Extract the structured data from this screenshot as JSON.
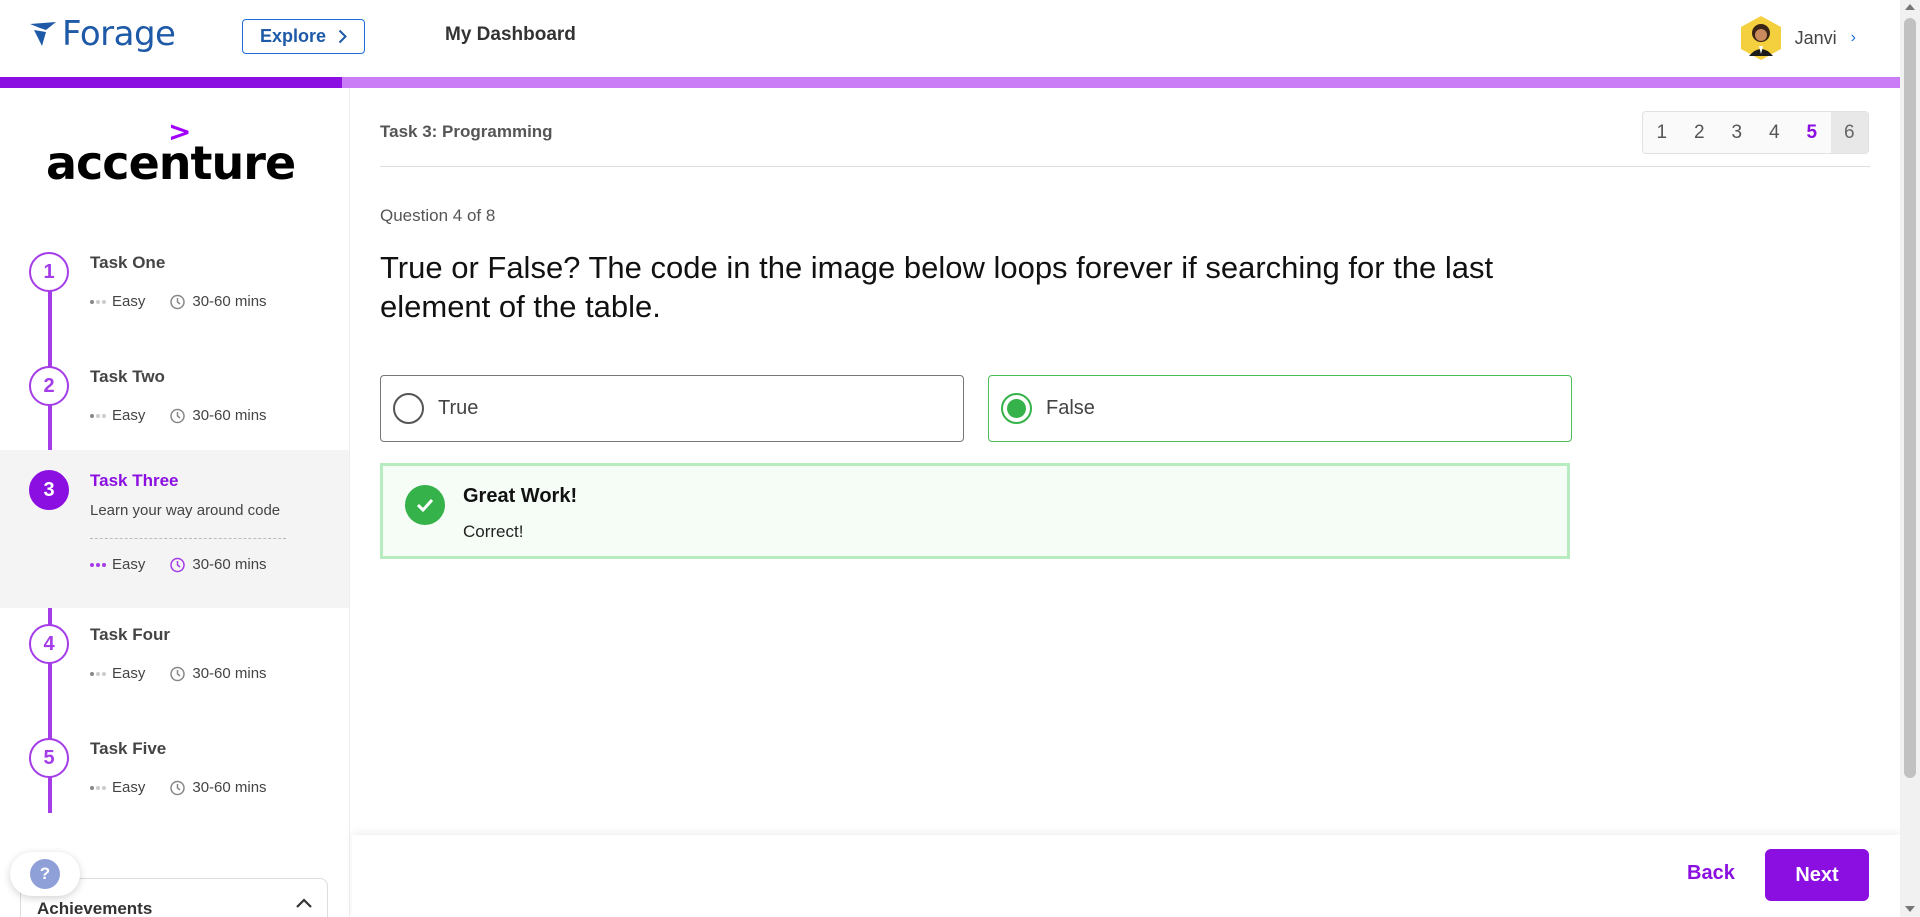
{
  "header": {
    "logo_text": "Forage",
    "explore_label": "Explore",
    "dashboard_label": "My Dashboard",
    "user_name": "Janvi",
    "progress_fraction": 0.18
  },
  "sidebar": {
    "brand": "accenture",
    "brand_mark": ">",
    "tasks": [
      {
        "number": "1",
        "title": "Task One",
        "difficulty": "Easy",
        "duration": "30-60 mins"
      },
      {
        "number": "2",
        "title": "Task Two",
        "difficulty": "Easy",
        "duration": "30-60 mins"
      },
      {
        "number": "3",
        "title": "Task Three",
        "description": "Learn your way around code",
        "difficulty": "Easy",
        "duration": "30-60 mins"
      },
      {
        "number": "4",
        "title": "Task Four",
        "difficulty": "Easy",
        "duration": "30-60 mins"
      },
      {
        "number": "5",
        "title": "Task Five",
        "difficulty": "Easy",
        "duration": "30-60 mins"
      }
    ],
    "help_label": "?",
    "achievements_label": "Achievements"
  },
  "main": {
    "task_label": "Task 3: Programming",
    "pages": [
      "1",
      "2",
      "3",
      "4",
      "5",
      "6"
    ],
    "current_page": "5",
    "question_count": "Question 4 of 8",
    "question_text": "True or False? The code in the image below loops forever if searching for the last element of the table.",
    "options": [
      {
        "label": "True",
        "selected": false
      },
      {
        "label": "False",
        "selected": true
      }
    ],
    "feedback": {
      "title": "Great Work!",
      "text": "Correct!"
    }
  },
  "footer": {
    "back_label": "Back",
    "next_label": "Next"
  },
  "colors": {
    "accent_purple": "#8a0fe0",
    "brand_blue": "#1e5aa8",
    "success_green": "#35b24a"
  }
}
